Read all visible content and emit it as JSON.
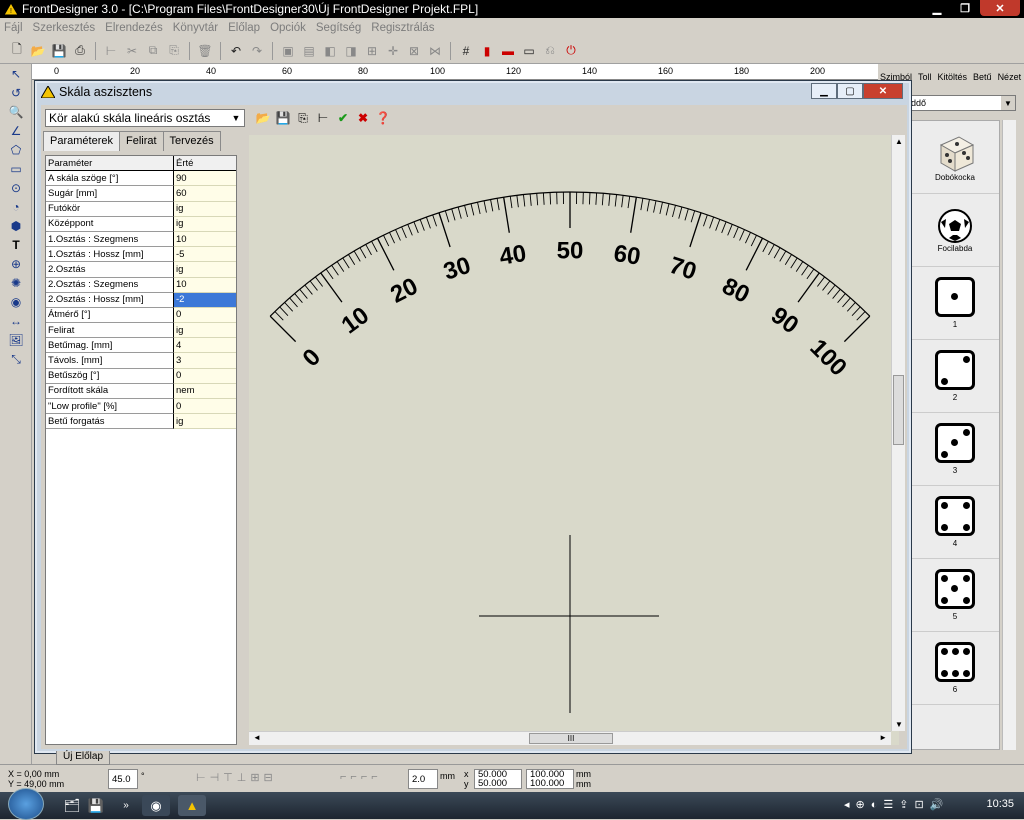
{
  "app": {
    "title": "FrontDesigner 3.0 - [C:\\Program Files\\FrontDesigner30\\Új FrontDesigner Projekt.FPL]"
  },
  "menu": [
    "Fájl",
    "Szerkesztés",
    "Elrendezés",
    "Könyvtár",
    "Előlap",
    "Opciók",
    "Segítség",
    "Regisztrálás"
  ],
  "ruler": [
    "0",
    "20",
    "40",
    "60",
    "80",
    "100",
    "120",
    "140",
    "160",
    "180",
    "200"
  ],
  "right_panel": {
    "tabs": [
      "Szimból",
      "Toll",
      "Kitöltés",
      "Betű",
      "Nézet"
    ],
    "select_value": "ddő",
    "items": [
      "Dobókocka",
      "Focilabda",
      "1",
      "2",
      "3",
      "4",
      "5",
      "6"
    ]
  },
  "dialog": {
    "title": "Skála aszisztens",
    "scale_type": "Kör alakú skála lineáris osztás",
    "tabs": [
      "Paraméterek",
      "Felirat",
      "Tervezés"
    ],
    "table_header": [
      "Paraméter",
      "Érté"
    ],
    "params": [
      [
        "A skála szöge [°]",
        "90"
      ],
      [
        "Sugár [mm]",
        "60"
      ],
      [
        "Futókör",
        "ig"
      ],
      [
        "Középpont",
        "ig"
      ],
      [
        "1.Osztás : Szegmens",
        "10"
      ],
      [
        "1.Osztás : Hossz [mm]",
        "-5"
      ],
      [
        "2.Osztás",
        "ig"
      ],
      [
        "2.Osztás : Szegmens",
        "10"
      ],
      [
        "2.Osztás : Hossz [mm]",
        "-2"
      ],
      [
        "Átmérő  [°]",
        "0"
      ],
      [
        "Felirat",
        "ig"
      ],
      [
        "Betűmag. [mm]",
        "4"
      ],
      [
        "Távols. [mm]",
        "3"
      ],
      [
        "Betűszög  [°]",
        "0"
      ],
      [
        "Fordított skála",
        "nem"
      ],
      [
        "\"Low profile\" [%]",
        "0"
      ],
      [
        "Betű forgatás",
        "ig"
      ]
    ],
    "selected_row": 8,
    "scroll_label": "III"
  },
  "chart_data": {
    "type": "scale",
    "min": 0,
    "max": 100,
    "major_step": 10,
    "minor_segments": 10,
    "angle_deg": 90,
    "labels": [
      "0",
      "10",
      "20",
      "30",
      "40",
      "50",
      "60",
      "70",
      "80",
      "90",
      "100"
    ]
  },
  "status": {
    "sheet_tab": "Új Előlap",
    "x_pos": "X = 0,00 mm",
    "y_pos": "Y = 49,00 mm",
    "angle": "45.0",
    "angle_unit": "°",
    "stroke": "2.0",
    "stroke_unit": "mm",
    "x_label": "x",
    "x_val": "50.000",
    "y_label": "y",
    "y_val": "50.000",
    "w_val": "100.000",
    "w_unit": "mm",
    "h_val": "100.000",
    "h_unit": "mm"
  },
  "taskbar": {
    "clock": "10:35"
  }
}
